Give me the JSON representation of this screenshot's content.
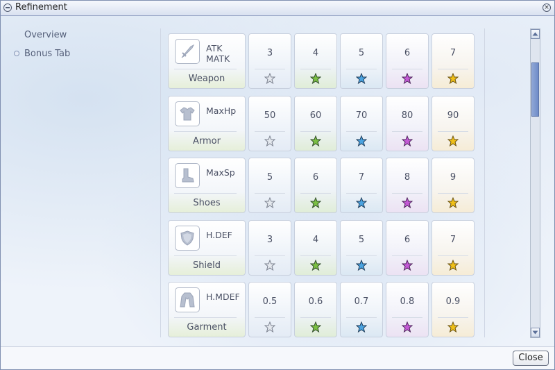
{
  "window": {
    "title": "Refinement"
  },
  "sidebar": {
    "items": [
      {
        "label": "Overview"
      },
      {
        "label": "Bonus Tab"
      }
    ]
  },
  "grid": {
    "rows": [
      {
        "name": "Weapon",
        "stat": "ATK\nMATK",
        "icon": "sword-icon",
        "values": [
          "3",
          "4",
          "5",
          "6",
          "7"
        ]
      },
      {
        "name": "Armor",
        "stat": "MaxHp",
        "icon": "armor-icon",
        "values": [
          "50",
          "60",
          "70",
          "80",
          "90"
        ]
      },
      {
        "name": "Shoes",
        "stat": "MaxSp",
        "icon": "boot-icon",
        "values": [
          "5",
          "6",
          "7",
          "8",
          "9"
        ]
      },
      {
        "name": "Shield",
        "stat": "H.DEF",
        "icon": "shield-icon",
        "values": [
          "3",
          "4",
          "5",
          "6",
          "7"
        ]
      },
      {
        "name": "Garment",
        "stat": "H.MDEF",
        "icon": "garment-icon",
        "values": [
          "0.5",
          "0.6",
          "0.7",
          "0.8",
          "0.9"
        ]
      }
    ],
    "star_colors": [
      "#e4e8ee",
      "#7bc043",
      "#4aa3e0",
      "#c45ad6",
      "#f0c018"
    ]
  },
  "footer": {
    "close_label": "Close"
  }
}
